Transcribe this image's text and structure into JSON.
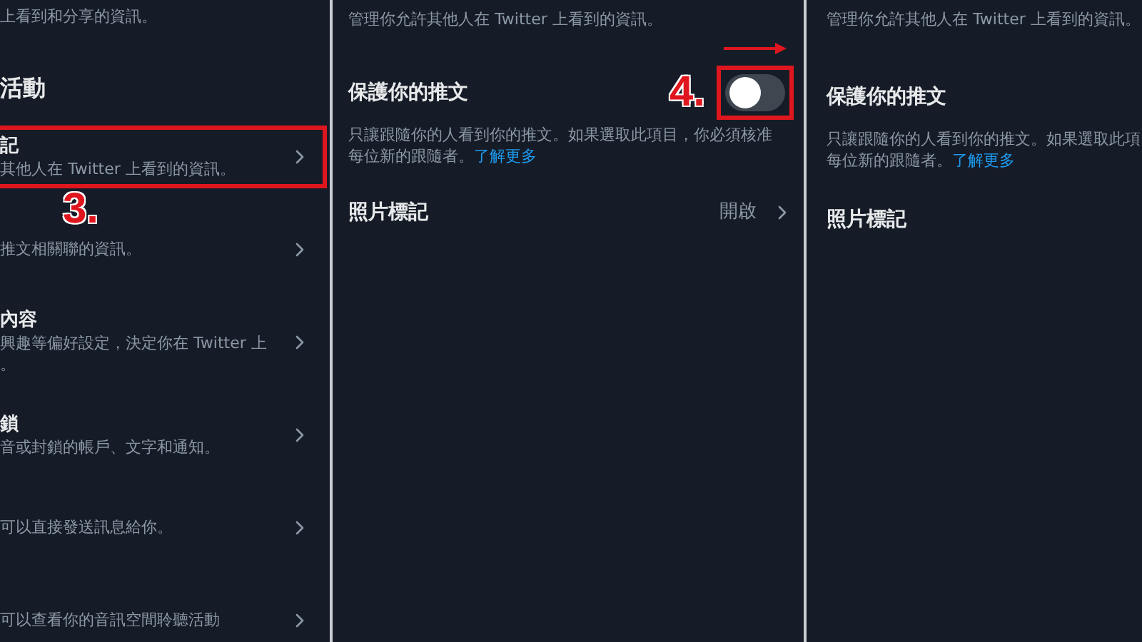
{
  "left_screen": {
    "intro": "上看到和分享的資訊。",
    "section_title": "活動",
    "items": [
      {
        "title": "記",
        "subtitle_lines": [
          "其他人在 Twitter 上看到的資訊。"
        ],
        "highlighted": true,
        "step": "3."
      },
      {
        "subtitle_lines": [
          "推文相關聯的資訊。"
        ],
        "highlighted": false
      },
      {
        "title": "內容",
        "subtitle_lines": [
          "興趣等偏好設定，決定你在 Twitter 上",
          "。"
        ],
        "highlighted": false
      },
      {
        "title": "鎖",
        "subtitle_lines": [
          "音或封鎖的帳戶、文字和通知。"
        ],
        "highlighted": false
      },
      {
        "subtitle_lines": [
          "可以直接發送訊息給你。"
        ],
        "highlighted": false
      },
      {
        "subtitle_lines": [
          "可以查看你的音訊空間聆聽活動"
        ],
        "highlighted": false
      }
    ]
  },
  "middle_screen": {
    "intro": "管理你允許其他人在 Twitter 上看到的資訊。",
    "protect": {
      "title": "保護你的推文",
      "on": false,
      "highlighted": true,
      "step": "4.",
      "description": "只讓跟隨你的人看到你的推文。如果選取此項目，你必須核准",
      "description_2": "每位新的跟隨者。",
      "link": "了解更多"
    },
    "photo_tagging": {
      "title": "照片標記",
      "value": "開啟"
    }
  },
  "right_screen": {
    "intro": "管理你允許其他人在 Twitter 上看到的資訊。",
    "protect": {
      "title": "保護你的推文",
      "description": "只讓跟隨你的人看到你的推文。如果選取此項",
      "description_2": "每位新的跟隨者。",
      "link": "了解更多"
    },
    "photo_tagging": {
      "title": "照片標記"
    }
  }
}
